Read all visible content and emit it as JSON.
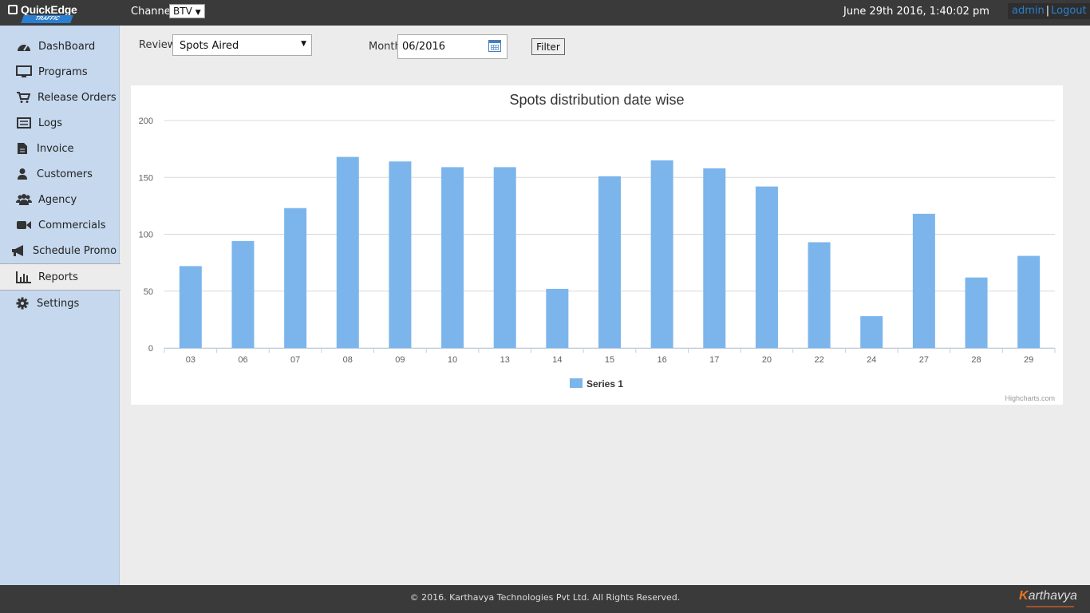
{
  "header": {
    "logo_text": "QuickEdge",
    "logo_sub": "TRAFFIC",
    "channel_label": "Channel",
    "channel_value": "BTV",
    "datetime": "June 29th 2016, 1:40:02 pm",
    "user_link": "admin",
    "separator": "|",
    "logout_link": "Logout"
  },
  "sidebar": {
    "items": [
      {
        "label": "DashBoard",
        "icon": "dashboard-icon"
      },
      {
        "label": "Programs",
        "icon": "monitor-icon"
      },
      {
        "label": "Release Orders",
        "icon": "cart-icon"
      },
      {
        "label": "Logs",
        "icon": "list-icon"
      },
      {
        "label": "Invoice",
        "icon": "document-icon"
      },
      {
        "label": "Customers",
        "icon": "user-icon"
      },
      {
        "label": "Agency",
        "icon": "users-icon"
      },
      {
        "label": "Commercials",
        "icon": "video-camera-icon"
      },
      {
        "label": "Schedule Promo",
        "icon": "megaphone-icon"
      },
      {
        "label": "Reports",
        "icon": "bar-chart-icon",
        "active": true
      },
      {
        "label": "Settings",
        "icon": "gear-icon"
      }
    ]
  },
  "filters": {
    "review_label": "Review",
    "review_value": "Spots Aired",
    "month_label": "Month",
    "month_value": "06/2016",
    "filter_button": "Filter"
  },
  "chart_data": {
    "type": "bar",
    "title": "Spots distribution date wise",
    "categories": [
      "03",
      "06",
      "07",
      "08",
      "09",
      "10",
      "13",
      "14",
      "15",
      "16",
      "17",
      "20",
      "22",
      "24",
      "27",
      "28",
      "29"
    ],
    "series": [
      {
        "name": "Series 1",
        "color": "#7cb5ec",
        "values": [
          72,
          94,
          123,
          168,
          164,
          159,
          159,
          52,
          151,
          165,
          158,
          142,
          93,
          28,
          118,
          62,
          81
        ]
      }
    ],
    "ylim": [
      0,
      200
    ],
    "yticks": [
      0,
      50,
      100,
      150,
      200
    ],
    "grid": true,
    "legend": "bottom-center",
    "credits": "Highcharts.com"
  },
  "footer": {
    "copyright": "© 2016. Karthavya Technologies Pvt Ltd. All Rights Reserved.",
    "brand_initial": "K",
    "brand_rest": "arthavya"
  }
}
